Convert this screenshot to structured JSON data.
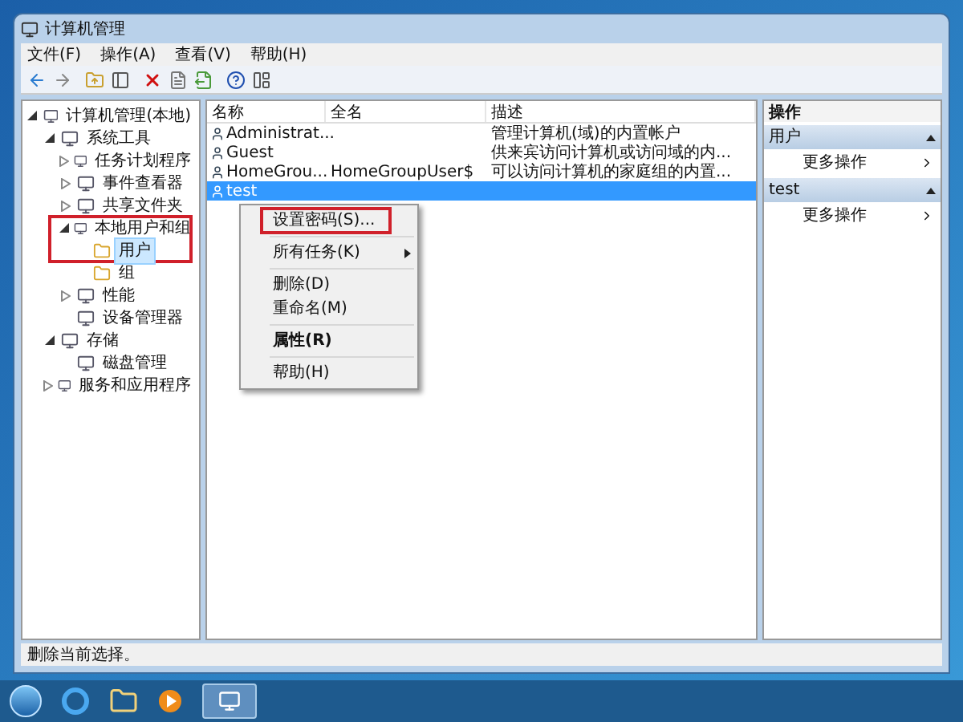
{
  "window": {
    "title": "计算机管理"
  },
  "menu": [
    "文件(F)",
    "操作(A)",
    "查看(V)",
    "帮助(H)"
  ],
  "tree": [
    {
      "label": "计算机管理(本地)",
      "selected": false,
      "expanded": true,
      "children": [
        {
          "label": "系统工具",
          "selected": false,
          "expanded": true,
          "children": [
            {
              "label": "任务计划程序",
              "selected": false,
              "expanded": false
            },
            {
              "label": "事件查看器",
              "selected": false,
              "expanded": false
            },
            {
              "label": "共享文件夹",
              "selected": false,
              "expanded": false
            },
            {
              "label": "本地用户和组",
              "selected": false,
              "expanded": true,
              "annotated": true,
              "children": [
                {
                  "label": "用户",
                  "selected": true
                },
                {
                  "label": "组",
                  "selected": false
                }
              ]
            },
            {
              "label": "性能",
              "selected": false,
              "expanded": false
            },
            {
              "label": "设备管理器",
              "selected": false
            }
          ]
        },
        {
          "label": "存储",
          "selected": false,
          "expanded": true,
          "children": [
            {
              "label": "磁盘管理",
              "selected": false
            }
          ]
        },
        {
          "label": "服务和应用程序",
          "selected": false,
          "expanded": false
        }
      ]
    }
  ],
  "table": {
    "columns": [
      "名称",
      "全名",
      "描述"
    ],
    "rows": [
      {
        "name": "Administrat...",
        "full_name": "",
        "description": "管理计算机(域)的内置帐户",
        "selected": false
      },
      {
        "name": "Guest",
        "full_name": "",
        "description": "供来宾访问计算机或访问域的内...",
        "selected": false
      },
      {
        "name": "HomeGrou...",
        "full_name": "HomeGroupUser$",
        "description": "可以访问计算机的家庭组的内置...",
        "selected": false
      },
      {
        "name": "test",
        "full_name": "",
        "description": "",
        "selected": true
      }
    ]
  },
  "context_menu": [
    {
      "kind": "item",
      "label": "设置密码(S)...",
      "annotated": true
    },
    {
      "kind": "separator"
    },
    {
      "kind": "submenu",
      "label": "所有任务(K)",
      "annotated": false
    },
    {
      "kind": "separator"
    },
    {
      "kind": "item",
      "label": "删除(D)",
      "annotated": false
    },
    {
      "kind": "item",
      "label": "重命名(M)",
      "annotated": false
    },
    {
      "kind": "separator"
    },
    {
      "kind": "default",
      "label": "属性(R)",
      "annotated": false
    },
    {
      "kind": "separator"
    },
    {
      "kind": "item",
      "label": "帮助(H)",
      "annotated": false
    }
  ],
  "actions": {
    "title": "操作",
    "sections": [
      {
        "title": "用户",
        "items": [
          "更多操作"
        ]
      },
      {
        "title": "test",
        "items": [
          "更多操作"
        ]
      }
    ]
  },
  "status_bar": "删除当前选择。"
}
